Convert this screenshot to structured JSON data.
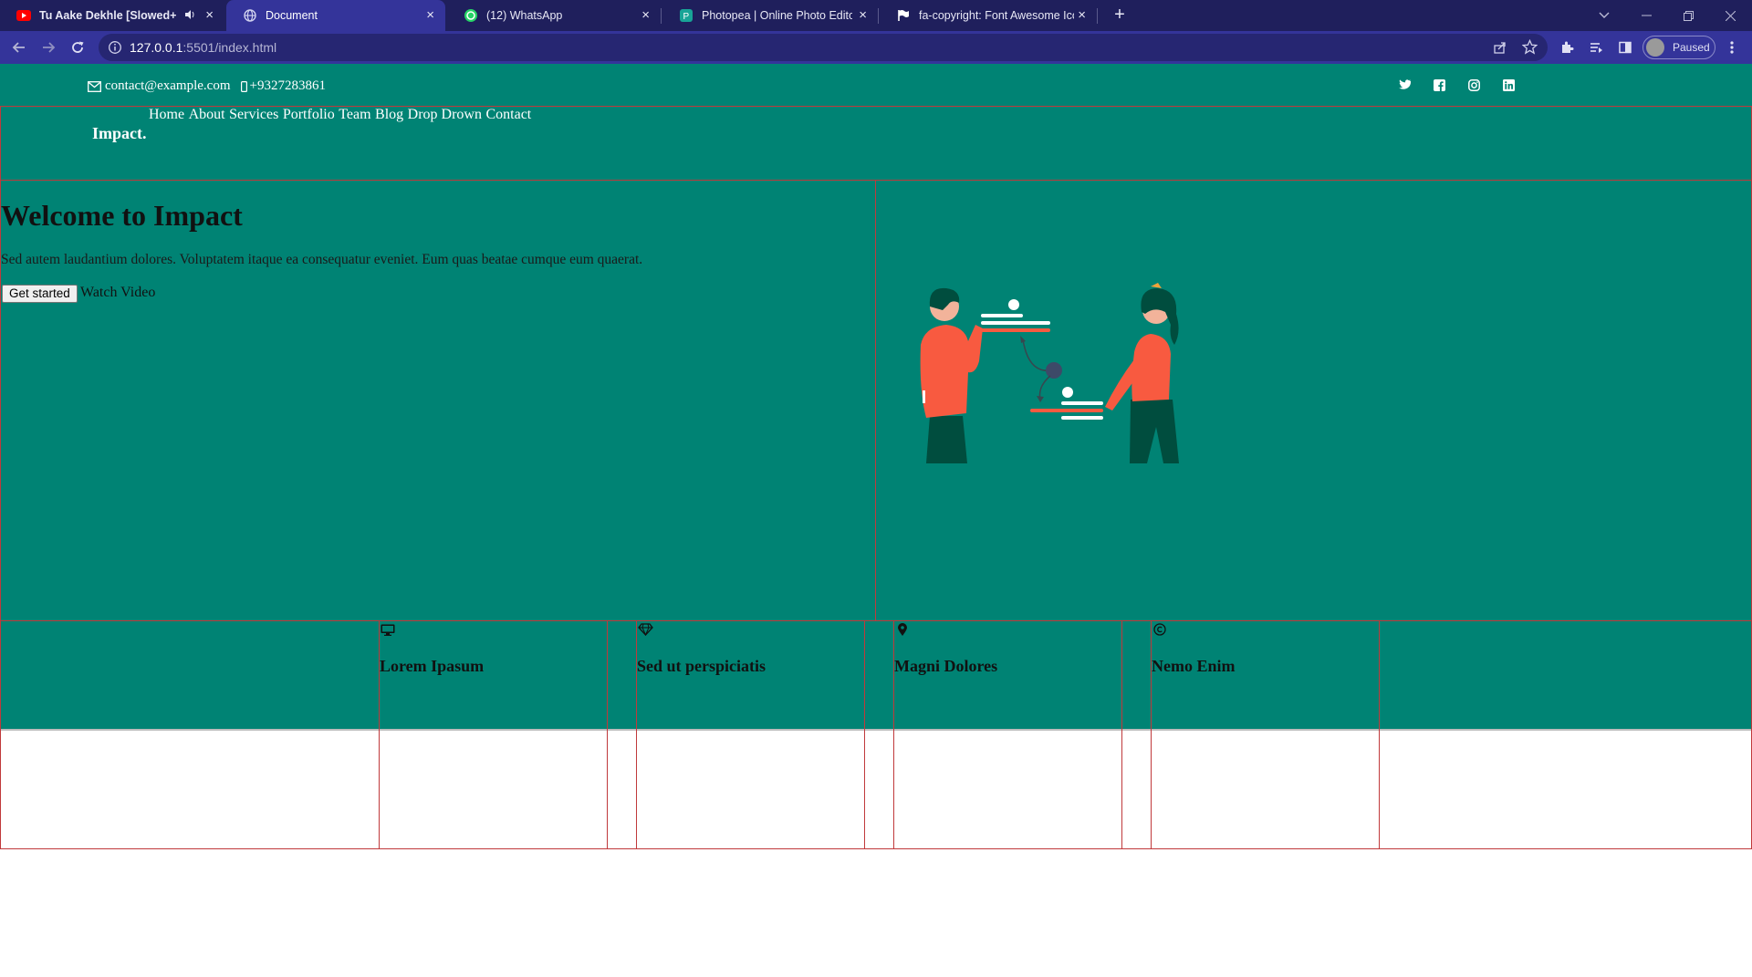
{
  "browser": {
    "tabs": [
      {
        "title": "Tu Aake Dekhle [Slowed+R",
        "favicon": "youtube-icon",
        "active": false
      },
      {
        "title": "Document",
        "favicon": "globe-icon",
        "active": true
      },
      {
        "title": "(12) WhatsApp",
        "favicon": "whatsapp-icon",
        "active": false
      },
      {
        "title": "Photopea | Online Photo Editor",
        "favicon": "photopea-icon",
        "active": false
      },
      {
        "title": "fa-copyright: Font Awesome Icon",
        "favicon": "flag-icon",
        "active": false
      }
    ],
    "url_host": "127.0.0.1",
    "url_rest": ":5501/index.html",
    "profile_label": "Paused",
    "colors": {
      "tabbar": "#1f1f5c",
      "toolbar": "#34349a"
    }
  },
  "page": {
    "topbar": {
      "email": "contact@example.com",
      "phone": "+9327283861",
      "socials": [
        "twitter-icon",
        "facebook-icon",
        "instagram-icon",
        "linkedin-icon"
      ]
    },
    "header": {
      "logo": "Impact.",
      "nav": [
        "Home",
        "About",
        "Services",
        "Portfolio",
        "Team",
        "Blog",
        "Drop Drown",
        "Contact"
      ]
    },
    "hero": {
      "title": "Welcome to Impact",
      "text": "Sed autem laudantium dolores. Voluptatem itaque ea consequatur eveniet. Eum quas beatae cumque eum quaerat.",
      "cta": "Get started",
      "video": "Watch Video"
    },
    "services": [
      {
        "icon": "monitor-icon",
        "title": "Lorem Ipasum"
      },
      {
        "icon": "diamond-icon",
        "title": "Sed ut perspiciatis"
      },
      {
        "icon": "map-pin-icon",
        "title": "Magni Dolores"
      },
      {
        "icon": "copyright-icon",
        "title": "Nemo Enim"
      }
    ],
    "colors": {
      "brand": "#008374",
      "outline": "#c0393b",
      "accent": "#f85a40"
    }
  }
}
